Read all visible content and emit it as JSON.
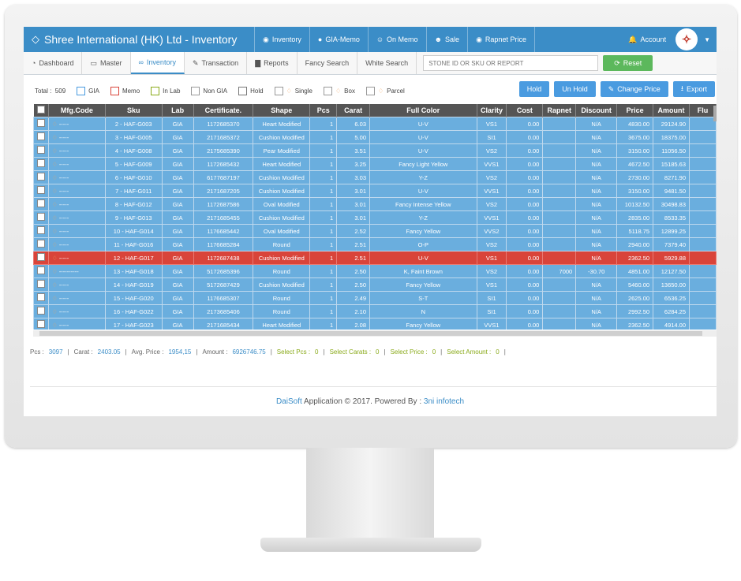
{
  "app": {
    "title": "Shree International (HK) Ltd - Inventory",
    "top_nav": [
      {
        "icon": "eye-icon",
        "label": "Inventory"
      },
      {
        "icon": "circle-icon",
        "label": "GIA-Memo"
      },
      {
        "icon": "users-icon",
        "label": "On Memo"
      },
      {
        "icon": "user-icon",
        "label": "Sale"
      },
      {
        "icon": "eye-icon",
        "label": "Rapnet Price"
      }
    ],
    "account_label": "Account"
  },
  "tabs": [
    {
      "icon": "dashboard-icon",
      "label": "Dashboard"
    },
    {
      "icon": "monitor-icon",
      "label": "Master"
    },
    {
      "icon": "link-icon",
      "label": "Inventory"
    },
    {
      "icon": "edit-icon",
      "label": "Transaction"
    },
    {
      "icon": "bar-chart-icon",
      "label": "Reports"
    },
    {
      "icon": "",
      "label": "Fancy Search"
    },
    {
      "icon": "",
      "label": "White Search"
    }
  ],
  "search": {
    "placeholder": "STONE ID OR SKU OR REPORT"
  },
  "reset_label": "Reset",
  "filters": {
    "total_label": "Total :",
    "total_value": "509",
    "items": [
      "GIA",
      "Memo",
      "In Lab",
      "Non GIA",
      "Hold",
      "Single",
      "Box",
      "Parcel"
    ],
    "colors": [
      "#4a9be0",
      "#d9443a",
      "#8aaa1a",
      "#999999",
      "#777777",
      "#999999",
      "#999999",
      "#999999"
    ]
  },
  "actions": [
    "Hold",
    "Un Hold",
    "Change Price",
    "Export"
  ],
  "table": {
    "columns": [
      "Mfg.Code",
      "Sku",
      "Lab",
      "Certificate.",
      "Shape",
      "Pcs",
      "Carat",
      "Full Color",
      "Clarity",
      "Cost",
      "Rapnet",
      "Discount",
      "Price",
      "Amount",
      "Flu"
    ],
    "rows": [
      [
        "-----",
        "2 - HAF-G003",
        "GIA",
        "1172685370",
        "Heart Modified",
        "1",
        "6.03",
        "U-V",
        "VS1",
        "0.00",
        "",
        "N/A",
        "4830.00",
        "29124.90"
      ],
      [
        "-----",
        "3 - HAF-G005",
        "GIA",
        "2171685372",
        "Cushion Modified",
        "1",
        "5.00",
        "U-V",
        "SI1",
        "0.00",
        "",
        "N/A",
        "3675.00",
        "18375.00"
      ],
      [
        "-----",
        "4 - HAF-G008",
        "GIA",
        "2175685390",
        "Pear Modified",
        "1",
        "3.51",
        "U-V",
        "VS2",
        "0.00",
        "",
        "N/A",
        "3150.00",
        "11056.50"
      ],
      [
        "-----",
        "5 - HAF-G009",
        "GIA",
        "1172685432",
        "Heart Modified",
        "1",
        "3.25",
        "Fancy Light Yellow",
        "VVS1",
        "0.00",
        "",
        "N/A",
        "4672.50",
        "15185.63"
      ],
      [
        "-----",
        "6 - HAF-G010",
        "GIA",
        "6177687197",
        "Cushion Modified",
        "1",
        "3.03",
        "Y-Z",
        "VS2",
        "0.00",
        "",
        "N/A",
        "2730.00",
        "8271.90"
      ],
      [
        "-----",
        "7 - HAF-G011",
        "GIA",
        "2171687205",
        "Cushion Modified",
        "1",
        "3.01",
        "U-V",
        "VVS1",
        "0.00",
        "",
        "N/A",
        "3150.00",
        "9481.50"
      ],
      [
        "-----",
        "8 - HAF-G012",
        "GIA",
        "1172687586",
        "Oval Modified",
        "1",
        "3.01",
        "Fancy Intense Yellow",
        "VS2",
        "0.00",
        "",
        "N/A",
        "10132.50",
        "30498.83"
      ],
      [
        "-----",
        "9 - HAF-G013",
        "GIA",
        "2171685455",
        "Cushion Modified",
        "1",
        "3.01",
        "Y-Z",
        "VVS1",
        "0.00",
        "",
        "N/A",
        "2835.00",
        "8533.35"
      ],
      [
        "-----",
        "10 - HAF-G014",
        "GIA",
        "1176685442",
        "Oval Modified",
        "1",
        "2.52",
        "Fancy Yellow",
        "VVS2",
        "0.00",
        "",
        "N/A",
        "5118.75",
        "12899.25"
      ],
      [
        "-----",
        "11 - HAF-G016",
        "GIA",
        "1176685284",
        "Round",
        "1",
        "2.51",
        "O-P",
        "VS2",
        "0.00",
        "",
        "N/A",
        "2940.00",
        "7379.40"
      ],
      [
        "-----",
        "12 - HAF-G017",
        "GIA",
        "1172687438",
        "Cushion Modified",
        "1",
        "2.51",
        "U-V",
        "VS1",
        "0.00",
        "",
        "N/A",
        "2362.50",
        "5929.88"
      ],
      [
        "----------",
        "13 - HAF-G018",
        "GIA",
        "5172685396",
        "Round",
        "1",
        "2.50",
        "K, Faint Brown",
        "VS2",
        "0.00",
        "7000",
        "-30.70",
        "4851.00",
        "12127.50"
      ],
      [
        "-----",
        "14 - HAF-G019",
        "GIA",
        "5172687429",
        "Cushion Modified",
        "1",
        "2.50",
        "Fancy Yellow",
        "VS1",
        "0.00",
        "",
        "N/A",
        "5460.00",
        "13650.00"
      ],
      [
        "-----",
        "15 - HAF-G020",
        "GIA",
        "1176685307",
        "Round",
        "1",
        "2.49",
        "S-T",
        "SI1",
        "0.00",
        "",
        "N/A",
        "2625.00",
        "6536.25"
      ],
      [
        "-----",
        "16 - HAF-G022",
        "GIA",
        "2173685406",
        "Round",
        "1",
        "2.10",
        "N",
        "SI1",
        "0.00",
        "",
        "N/A",
        "2992.50",
        "6284.25"
      ],
      [
        "-----",
        "17 - HAF-G023",
        "GIA",
        "2171685434",
        "Heart Modified",
        "1",
        "2.08",
        "Fancy Yellow",
        "VVS1",
        "0.00",
        "",
        "N/A",
        "2362.50",
        "4914.00"
      ]
    ],
    "selected_row_index": 10
  },
  "summary": {
    "pcs_label": "Pcs :",
    "pcs": "3097",
    "carat_label": "Carat :",
    "carat": "2403.05",
    "avg_label": "Avg. Price :",
    "avg": "1954,15",
    "amount_label": "Amount :",
    "amount": "6926746.75",
    "sel_pcs_label": "Select Pcs :",
    "sel_pcs": "0",
    "sel_carats_label": "Select Carats :",
    "sel_carats": "0",
    "sel_price_label": "Select Price :",
    "sel_price": "0",
    "sel_amount_label": "Select Amount :",
    "sel_amount": "0"
  },
  "footer": {
    "brand": "DaiSoft",
    "text": "Application © 2017. Powered By :",
    "company": "3ni infotech"
  }
}
